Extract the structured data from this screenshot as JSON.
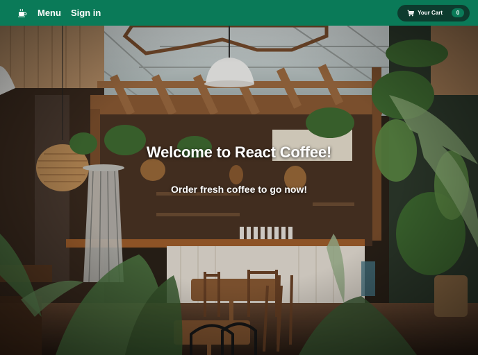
{
  "nav": {
    "brand_icon": "coffee-cup-icon",
    "menu_label": "Menu",
    "signin_label": "Sign in"
  },
  "cart": {
    "icon": "shopping-cart-icon",
    "label": "Your Cart",
    "count": "0"
  },
  "hero": {
    "title": "Welcome to React Coffee!",
    "subtitle": "Order fresh coffee to go now!"
  },
  "colors": {
    "nav_background": "#0a7a58",
    "cart_background": "#0d3b2e",
    "badge_background": "#0a7a58",
    "text": "#ffffff"
  }
}
